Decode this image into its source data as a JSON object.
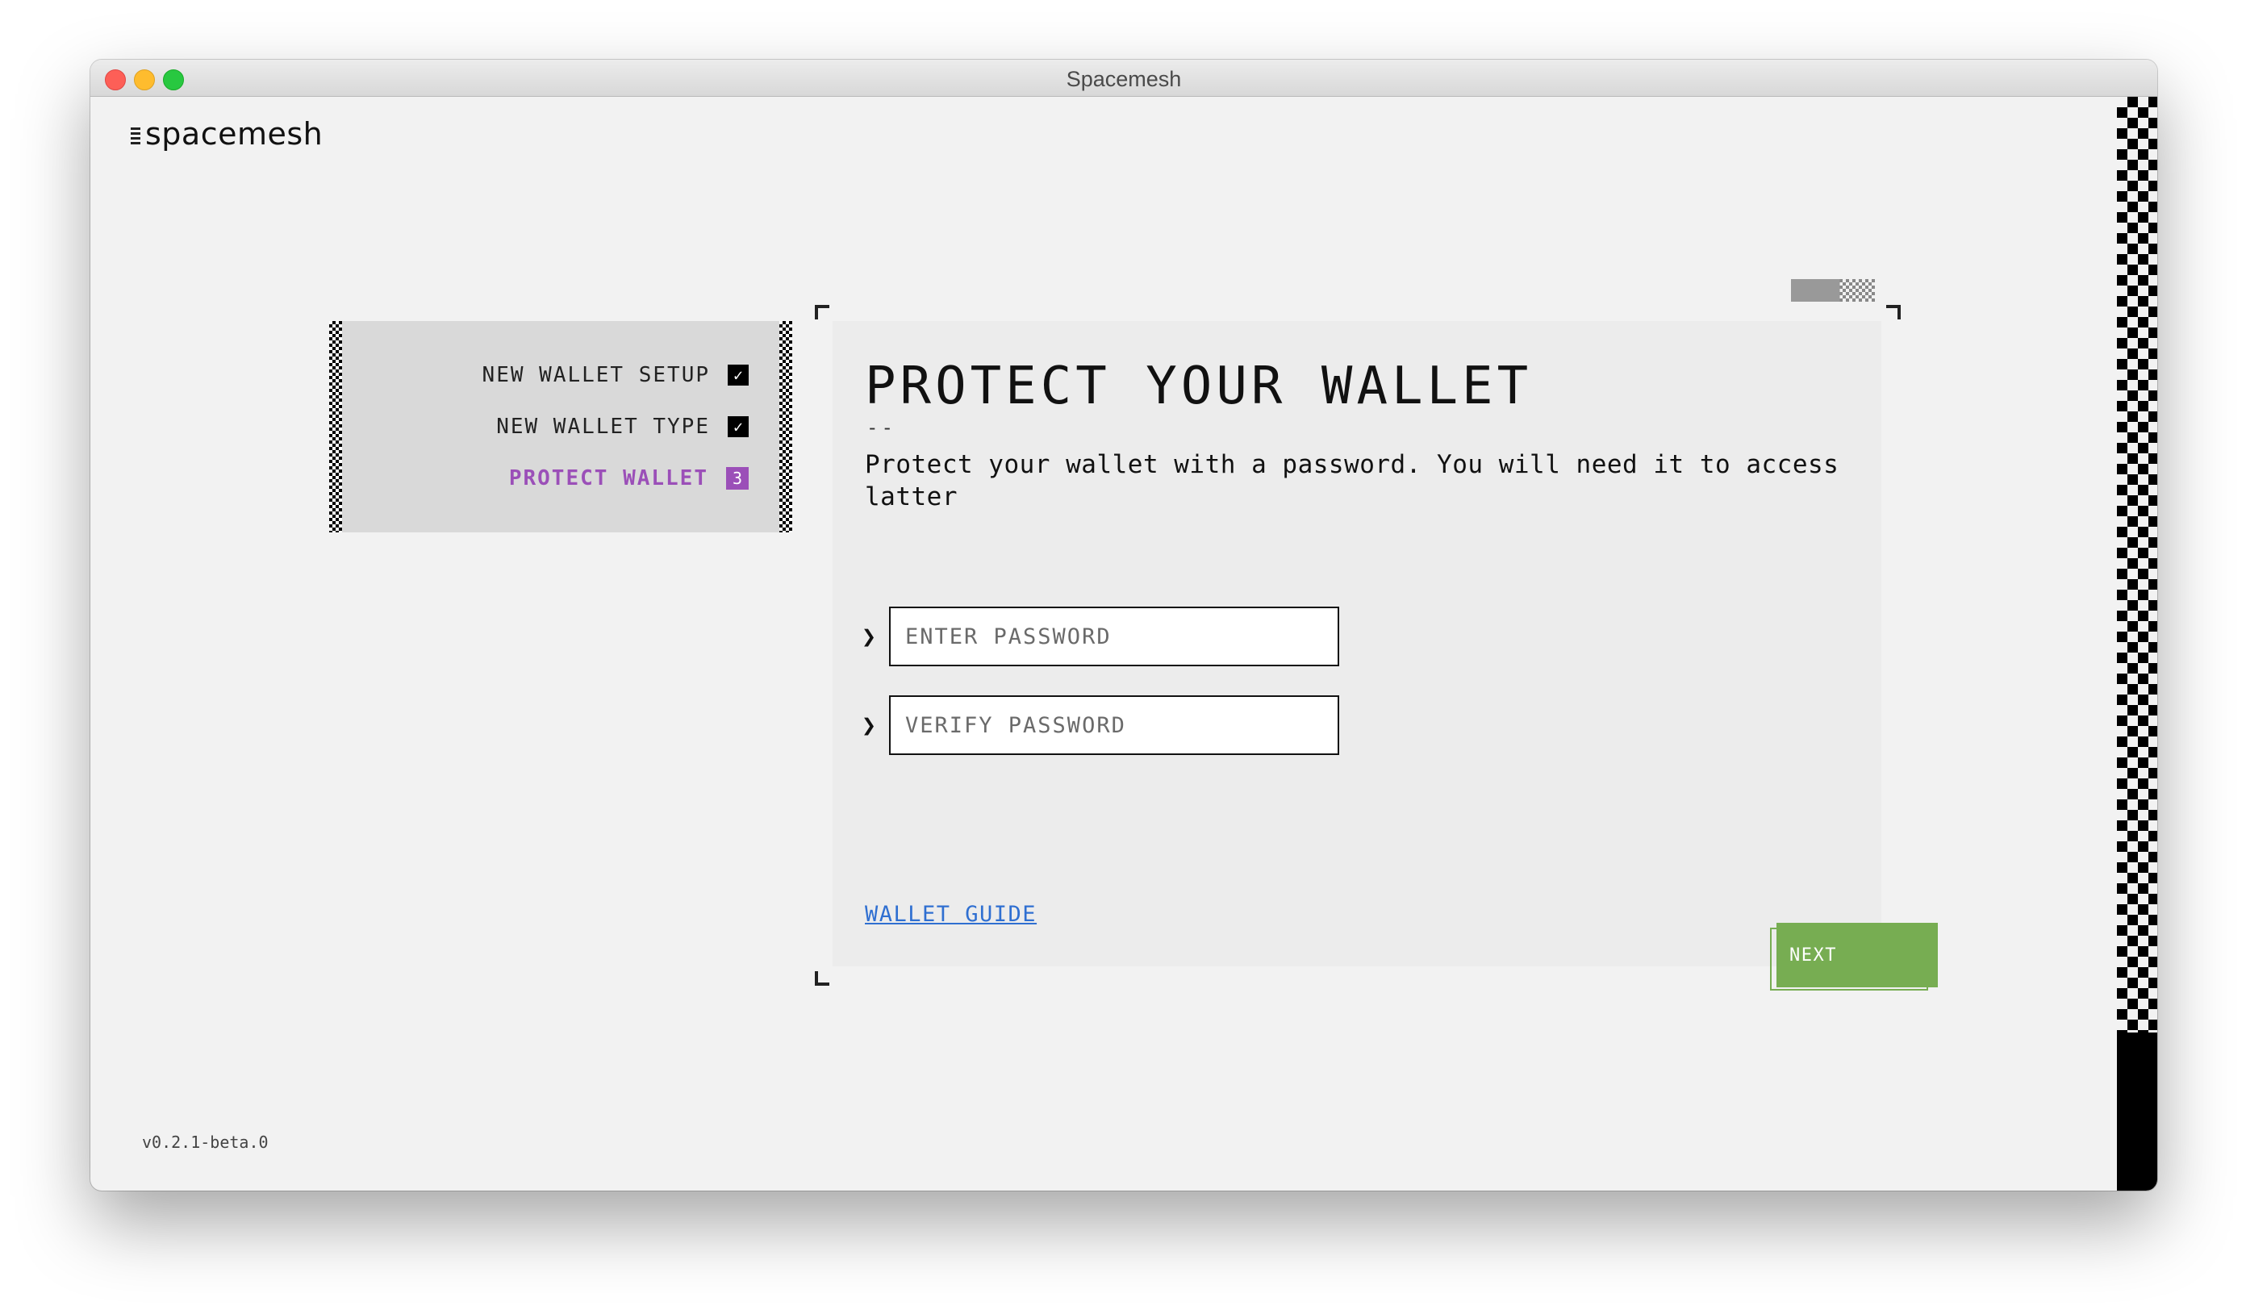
{
  "window": {
    "title": "Spacemesh"
  },
  "app": {
    "logo_text": "spacemesh",
    "version": "v0.2.1-beta.0"
  },
  "steps": [
    {
      "label": "NEW WALLET SETUP",
      "status": "done",
      "mark": "✓"
    },
    {
      "label": "NEW WALLET TYPE",
      "status": "done",
      "mark": "✓"
    },
    {
      "label": "PROTECT WALLET",
      "status": "active",
      "mark": "3"
    }
  ],
  "card": {
    "title": "PROTECT YOUR WALLET",
    "dash": "--",
    "subtitle": "Protect your wallet with a password. You will need it to access latter",
    "password_placeholder": "ENTER PASSWORD",
    "verify_placeholder": "VERIFY PASSWORD",
    "guide_link": "WALLET GUIDE",
    "next_label": "NEXT"
  },
  "colors": {
    "accent_purple": "#9b4fb8",
    "accent_green": "#77ad52",
    "link_blue": "#2f6fd1"
  }
}
